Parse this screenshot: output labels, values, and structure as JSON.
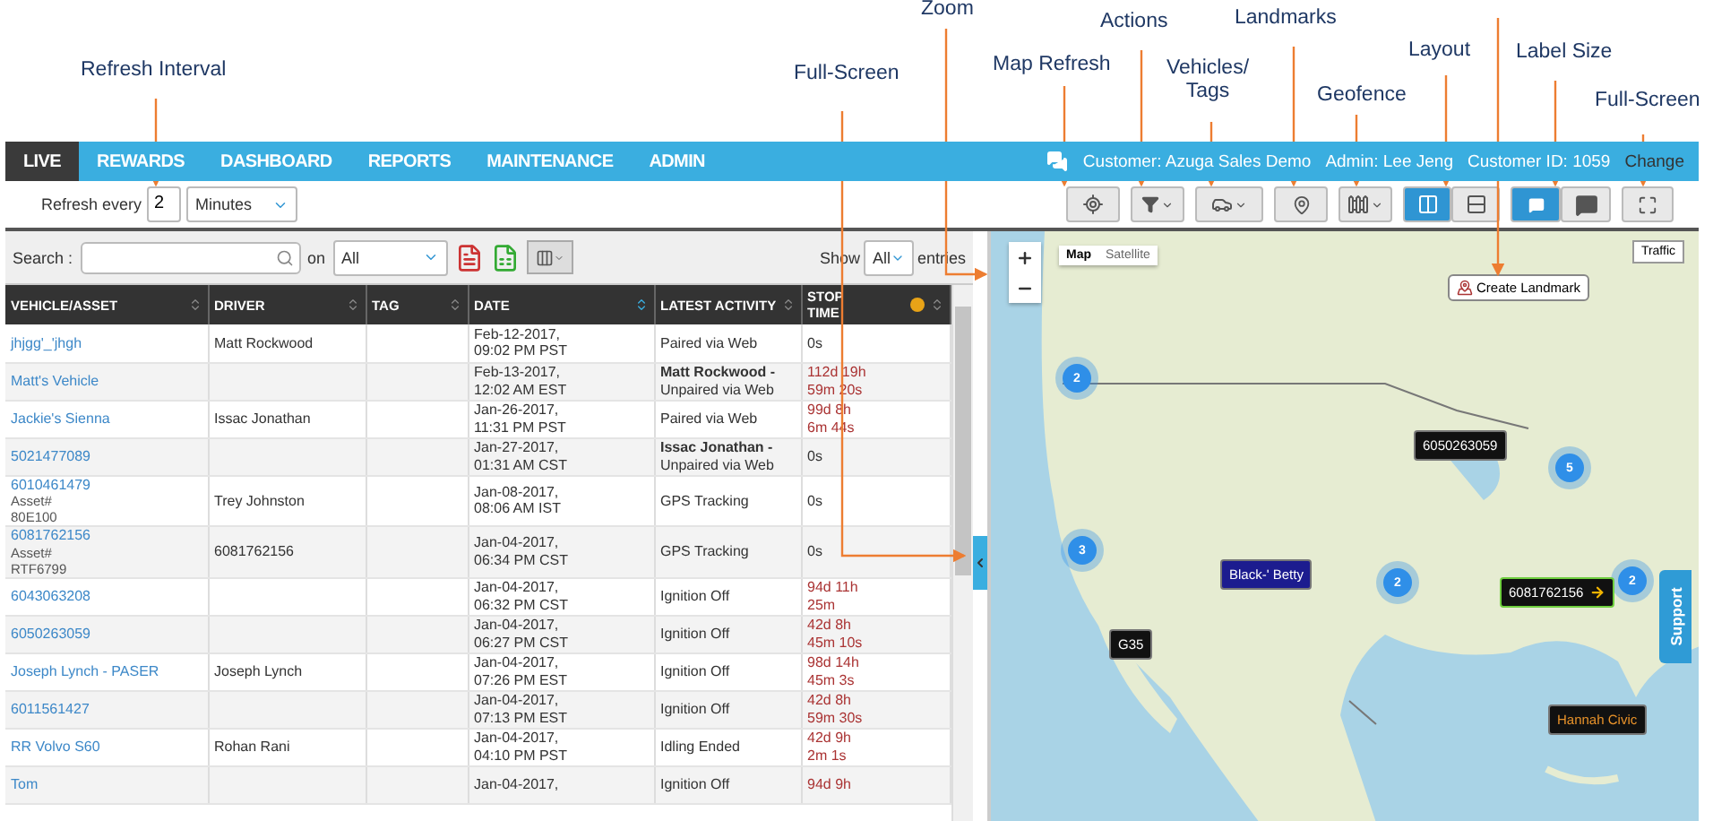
{
  "annotations": [
    {
      "text": "Refresh Interval"
    },
    {
      "text": "Full-Screen"
    },
    {
      "text": "Zoom"
    },
    {
      "text": "Map Refresh"
    },
    {
      "text": "Actions"
    },
    {
      "text": "Vehicles/\nTags"
    },
    {
      "text": "Landmarks"
    },
    {
      "text": "Geofence"
    },
    {
      "text": "Layout"
    },
    {
      "text": "Label Size"
    },
    {
      "text": "Full-Screen"
    }
  ],
  "nav": {
    "tabs": [
      {
        "label": "LIVE",
        "selected": true
      },
      {
        "label": "REWARDS",
        "selected": false
      },
      {
        "label": "DASHBOARD",
        "selected": false
      },
      {
        "label": "REPORTS",
        "selected": false
      },
      {
        "label": "MAINTENANCE",
        "selected": false
      },
      {
        "label": "ADMIN",
        "selected": false
      }
    ],
    "customer": "Customer: Azuga Sales Demo",
    "admin": "Admin: Lee Jeng",
    "customer_id": "Customer ID: 1059",
    "change_link": "Change"
  },
  "refresh": {
    "label": "Refresh every",
    "value": "2",
    "unit": "Minutes"
  },
  "map_toolbar": {
    "buttons": [
      {
        "kind": "refresh"
      },
      {
        "kind": "filter"
      },
      {
        "kind": "vehicle"
      },
      {
        "kind": "landmark"
      },
      {
        "kind": "geofence"
      }
    ],
    "layout": [
      {
        "kind": "columns",
        "selected": true
      },
      {
        "kind": "rows",
        "selected": false
      }
    ],
    "label_size": [
      {
        "kind": "small",
        "selected": true
      },
      {
        "kind": "large",
        "selected": false
      }
    ],
    "fullscreen": {
      "kind": "expand"
    }
  },
  "search": {
    "label": "Search :",
    "on_label": "on",
    "on_value": "All",
    "show_label": "Show",
    "show_value": "All",
    "entries_label": "entries"
  },
  "table": {
    "columns": [
      {
        "label": "VEHICLE/ASSET",
        "sorted": false
      },
      {
        "label": "DRIVER",
        "sorted": false
      },
      {
        "label": "TAG",
        "sorted": false
      },
      {
        "label": "DATE",
        "sorted": true
      },
      {
        "label": "LATEST ACTIVITY",
        "sorted": false
      },
      {
        "label": "STOP TIME",
        "sorted": false
      }
    ],
    "rows": [
      {
        "vehicle": "jhjgg'_'jhgh",
        "driver": "Matt Rockwood",
        "tag": "",
        "date": "Feb-12-2017,\n09:02 PM PST",
        "activity": "Paired via Web",
        "stop": "0s",
        "alert": false
      },
      {
        "vehicle": "Matt's Vehicle",
        "driver": "",
        "tag": "",
        "date": "Feb-13-2017,\n12:02 AM EST",
        "activity": "**Matt Rockwood -** Unpaired via Web",
        "stop": "112d 19h\n59m 20s",
        "alert": true
      },
      {
        "vehicle": "Jackie's Sienna",
        "driver": "Issac Jonathan",
        "tag": "",
        "date": "Jan-26-2017,\n11:31 PM PST",
        "activity": "Paired via Web",
        "stop": "99d 8h\n6m 44s",
        "alert": true
      },
      {
        "vehicle": "5021477089",
        "driver": "",
        "tag": "",
        "date": "Jan-27-2017,\n01:31 AM CST",
        "activity": "**Issac Jonathan -** Unpaired via Web",
        "stop": "0s",
        "alert": false
      },
      {
        "vehicle": "6010461479",
        "asset_label": "Asset#",
        "asset": "80E100",
        "driver": "Trey Johnston",
        "tag": "",
        "date": "Jan-08-2017,\n08:06 AM IST",
        "activity": "GPS Tracking",
        "stop": "0s",
        "alert": false
      },
      {
        "vehicle": "6081762156",
        "asset_label": "Asset#",
        "asset": "RTF6799",
        "driver": "6081762156",
        "tag": "",
        "date": "Jan-04-2017,\n06:34 PM CST",
        "activity": "GPS Tracking",
        "stop": "0s",
        "alert": false
      },
      {
        "vehicle": "6043063208",
        "driver": "",
        "tag": "",
        "date": "Jan-04-2017,\n06:32 PM CST",
        "activity": "Ignition Off",
        "stop": "94d 11h\n25m",
        "alert": true
      },
      {
        "vehicle": "6050263059",
        "driver": "",
        "tag": "",
        "date": "Jan-04-2017,\n06:27 PM CST",
        "activity": "Ignition Off",
        "stop": "42d 8h\n45m 10s",
        "alert": true
      },
      {
        "vehicle": "Joseph Lynch - PASER",
        "driver": "Joseph Lynch",
        "tag": "",
        "date": "Jan-04-2017,\n07:26 PM EST",
        "activity": "Ignition Off",
        "stop": "98d 14h\n45m 3s",
        "alert": true
      },
      {
        "vehicle": "6011561427",
        "driver": "",
        "tag": "",
        "date": "Jan-04-2017,\n07:13 PM EST",
        "activity": "Ignition Off",
        "stop": "42d 8h\n59m 30s",
        "alert": true
      },
      {
        "vehicle": "RR Volvo S60",
        "driver": "Rohan Rani",
        "tag": "",
        "date": "Jan-04-2017,\n04:10 PM PST",
        "activity": "Idling Ended",
        "stop": "42d 9h\n2m 1s",
        "alert": true
      },
      {
        "vehicle": "Tom",
        "driver": "",
        "tag": "",
        "date": "Jan-04-2017,",
        "activity": "Ignition Off",
        "stop": "94d 9h",
        "alert": true
      }
    ]
  },
  "map": {
    "type_buttons": [
      {
        "label": "Map",
        "selected": true
      },
      {
        "label": "Satellite",
        "selected": false
      }
    ],
    "traffic": "Traffic",
    "create_landmark": "Create Landmark",
    "support": "Support",
    "markers": [
      {
        "kind": "cluster",
        "text": "2"
      },
      {
        "kind": "cluster",
        "text": "5"
      },
      {
        "kind": "cluster",
        "text": "3"
      },
      {
        "kind": "cluster",
        "text": "2"
      },
      {
        "kind": "cluster",
        "text": "2"
      },
      {
        "kind": "label",
        "text": "6050263059",
        "color": "#111111"
      },
      {
        "kind": "label",
        "text": "Black-' Betty",
        "color": "#1c1c8f"
      },
      {
        "kind": "moving_label",
        "text": "6081762156",
        "color": "#111111"
      },
      {
        "kind": "label",
        "text": "G35",
        "color": "#111111"
      },
      {
        "kind": "idle_label",
        "text": "Hannah Civic",
        "color": "#111111"
      }
    ]
  }
}
